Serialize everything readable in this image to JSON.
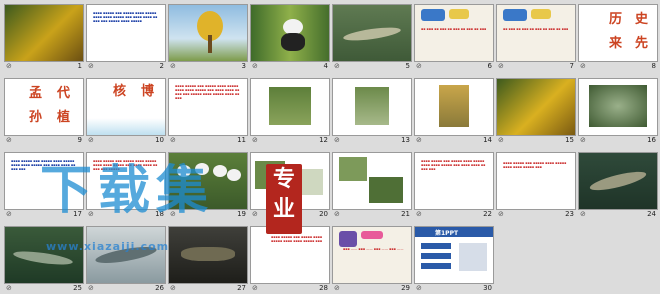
{
  "slides": [
    {
      "n": "1",
      "mark": "⊘"
    },
    {
      "n": "2",
      "mark": "⊘"
    },
    {
      "n": "3",
      "mark": "⊘"
    },
    {
      "n": "4",
      "mark": "⊘"
    },
    {
      "n": "5",
      "mark": "⊘"
    },
    {
      "n": "6",
      "mark": "⊘"
    },
    {
      "n": "7",
      "mark": "⊘"
    },
    {
      "n": "8",
      "mark": "⊘"
    },
    {
      "n": "9",
      "mark": "⊘"
    },
    {
      "n": "10",
      "mark": "⊘"
    },
    {
      "n": "11",
      "mark": "⊘"
    },
    {
      "n": "12",
      "mark": "⊘"
    },
    {
      "n": "13",
      "mark": "⊘"
    },
    {
      "n": "14",
      "mark": "⊘"
    },
    {
      "n": "15",
      "mark": "⊘"
    },
    {
      "n": "16",
      "mark": "⊘"
    },
    {
      "n": "17",
      "mark": "⊘"
    },
    {
      "n": "18",
      "mark": "⊘"
    },
    {
      "n": "19",
      "mark": "⊘"
    },
    {
      "n": "20",
      "mark": "⊘"
    },
    {
      "n": "21",
      "mark": "⊘"
    },
    {
      "n": "22",
      "mark": "⊘"
    },
    {
      "n": "23",
      "mark": "⊘"
    },
    {
      "n": "24",
      "mark": "⊘"
    },
    {
      "n": "25",
      "mark": "⊘"
    },
    {
      "n": "26",
      "mark": "⊘"
    },
    {
      "n": "27",
      "mark": "⊘"
    },
    {
      "n": "28",
      "mark": "⊘"
    },
    {
      "n": "29",
      "mark": "⊘"
    },
    {
      "n": "30",
      "mark": "⊘"
    }
  ],
  "slide8": {
    "c1": "历",
    "c2": "史",
    "c3": "来",
    "c4": "先"
  },
  "slide9": {
    "c1": "孟",
    "c2": "代",
    "c3": "孙",
    "c4": "植"
  },
  "slide10": {
    "c1": "核",
    "c2": "博"
  },
  "slide30": {
    "logo": "第1PPT"
  },
  "watermark": {
    "main": "下载集",
    "url": "www.xiazaiji.com",
    "seal": "专业"
  }
}
